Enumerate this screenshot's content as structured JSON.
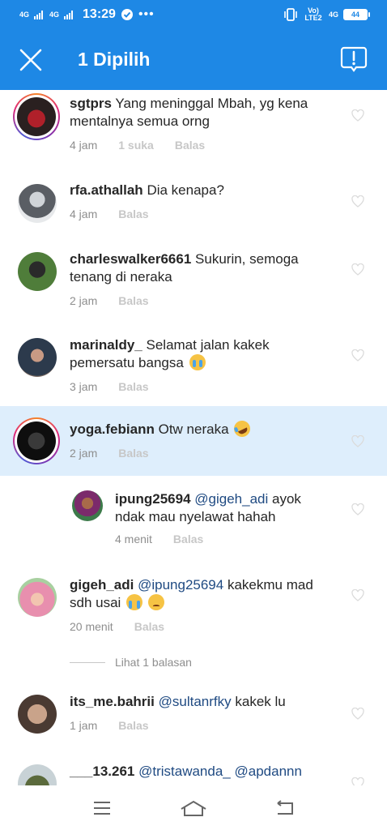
{
  "status_bar": {
    "net1": "4G",
    "net2": "4G",
    "time": "13:29",
    "volte": "Vo) LTE2",
    "net3": "4G",
    "battery": "44"
  },
  "header": {
    "title": "1 Dipilih",
    "close_icon": "close-icon",
    "report_icon": "report-icon"
  },
  "comments": [
    {
      "user": "sgtprs",
      "text": "Yang meninggal Mbah, yg kena mentalnya semua orng",
      "time": "4 jam",
      "likes": "1 suka",
      "reply": "Balas"
    },
    {
      "user": "rfa.athallah",
      "text": "Dia kenapa?",
      "time": "4 jam",
      "reply": "Balas"
    },
    {
      "user": "charleswalker6661",
      "text": "Sukurin, semoga tenang di neraka",
      "time": "2 jam",
      "reply": "Balas"
    },
    {
      "user": "marinaldy_",
      "text": "Selamat jalan kakek pemersatu bangsa",
      "time": "3 jam",
      "reply": "Balas"
    },
    {
      "user": "yoga.febiann",
      "text": "Otw neraka",
      "time": "2 jam",
      "reply": "Balas"
    },
    {
      "user": "ipung25694",
      "mention": "@gigeh_adi",
      "text": "ayok ndak mau nyelawat hahah",
      "time": "4 menit",
      "reply": "Balas"
    },
    {
      "user": "gigeh_adi",
      "mention": "@ipung25694",
      "text": "kakekmu mad sdh usai",
      "time": "20 menit",
      "reply": "Balas"
    },
    {
      "user": "its_me.bahrii",
      "mention": "@sultanrfky",
      "text": "kakek lu",
      "time": "1 jam",
      "reply": "Balas"
    },
    {
      "user": "___13.261",
      "mention": "@tristawanda_",
      "mention2": "@apdannn"
    }
  ],
  "view_replies": "Lihat 1 balasan",
  "colors": {
    "accent": "#1e88e5",
    "selected": "#deeefc",
    "mention": "#1f4a82"
  }
}
